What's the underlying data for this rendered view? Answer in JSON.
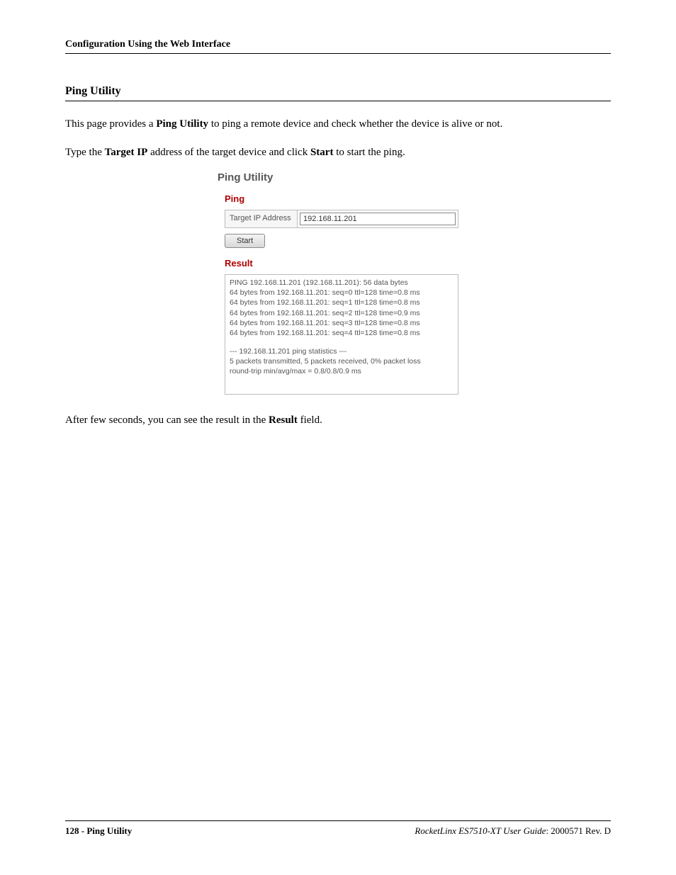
{
  "header": {
    "title": "Configuration Using the Web Interface"
  },
  "section": {
    "title": "Ping Utility"
  },
  "para1": {
    "pre": "This page provides a ",
    "b1": "Ping Utility",
    "post": " to ping a remote device and check whether the device is alive or not."
  },
  "para2": {
    "pre": "Type the ",
    "b1": "Target IP",
    "mid": " address of the target device and click ",
    "b2": "Start",
    "post": " to start the ping."
  },
  "shot": {
    "title": "Ping Utility",
    "ping_head": "Ping",
    "target_label": "Target IP Address",
    "target_value": "192.168.11.201",
    "start_label": "Start",
    "result_head": "Result",
    "lines": [
      "PING 192.168.11.201 (192.168.11.201): 56 data bytes",
      "64 bytes from 192.168.11.201: seq=0 ttl=128 time=0.8 ms",
      "64 bytes from 192.168.11.201: seq=1 ttl=128 time=0.8 ms",
      "64 bytes from 192.168.11.201: seq=2 ttl=128 time=0.9 ms",
      "64 bytes from 192.168.11.201: seq=3 ttl=128 time=0.8 ms",
      "64 bytes from 192.168.11.201: seq=4 ttl=128 time=0.8 ms"
    ],
    "stats": [
      "--- 192.168.11.201 ping statistics ---",
      "5 packets transmitted, 5 packets received, 0% packet loss",
      "round-trip min/avg/max = 0.8/0.8/0.9 ms"
    ]
  },
  "para3": {
    "pre": "After few seconds, you can see the result in the ",
    "b1": "Result",
    "post": " field."
  },
  "footer": {
    "page": "128",
    "sep": " - ",
    "section": "Ping Utility",
    "product": "RocketLinx ES7510-XT  User Guide",
    "tail": ": 2000571 Rev. D"
  }
}
